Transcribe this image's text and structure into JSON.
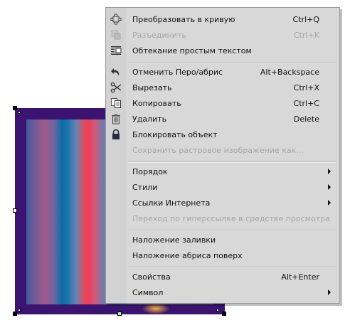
{
  "menu": {
    "items": [
      {
        "label": "Преобразовать в кривую",
        "shortcut": "Ctrl+Q",
        "icon": "convert-to-curve-icon"
      },
      {
        "label": "Разъединить",
        "shortcut": "Ctrl+K",
        "icon": "break-apart-icon",
        "disabled": true
      },
      {
        "label": "Обтекание простым текстом",
        "shortcut": "",
        "icon": "text-wrap-icon"
      },
      {
        "label": "Отменить Перо/абрис",
        "shortcut": "Alt+Backspace",
        "icon": "undo-icon"
      },
      {
        "label": "Вырезать",
        "shortcut": "Ctrl+X",
        "icon": "scissors-icon"
      },
      {
        "label": "Копировать",
        "shortcut": "Ctrl+C",
        "icon": "copy-icon"
      },
      {
        "label": "Удалить",
        "shortcut": "Delete",
        "icon": "trash-icon"
      },
      {
        "label": "Блокировать объект",
        "shortcut": "",
        "icon": "lock-icon"
      },
      {
        "label": "Сохранить растровое изображение как...",
        "shortcut": "",
        "disabled": true
      },
      {
        "label": "Порядок",
        "submenu": true
      },
      {
        "label": "Стили",
        "submenu": true
      },
      {
        "label": "Ссылки Интернета",
        "submenu": true
      },
      {
        "label": "Переход по гиперссылке в средстве просмотра",
        "disabled": true
      },
      {
        "label": "Наложение заливки"
      },
      {
        "label": "Наложение абриса поверх"
      },
      {
        "label": "Свойства",
        "shortcut": "Alt+Enter"
      },
      {
        "label": "Символ",
        "submenu": true
      }
    ]
  }
}
